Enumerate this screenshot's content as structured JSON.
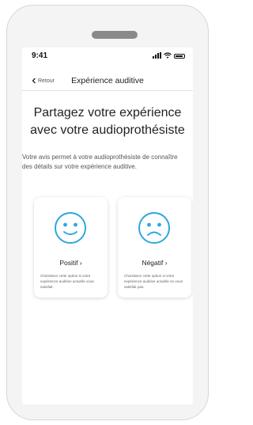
{
  "status_bar": {
    "time": "9:41"
  },
  "nav": {
    "back_label": "Retour",
    "title": "Expérience auditive"
  },
  "headline": {
    "line1": "Partagez votre expérience",
    "line2": "avec votre audioprothésiste"
  },
  "description": "Votre avis permet à votre audioprothésiste de connaître des détails sur votre expérience auditive.",
  "cards": [
    {
      "label": "Positif ›",
      "text": "Choisissez cette option si votre expérience auditive actuelle vous satisfait.",
      "icon": "happy-face-icon"
    },
    {
      "label": "Négatif ›",
      "text": "Choisissez cette option si votre expérience auditive actuelle ne vous satisfait pas.",
      "icon": "sad-face-icon"
    }
  ],
  "colors": {
    "accent": "#2aa8e0",
    "device_bezel": "#f4f4f4",
    "speaker": "#8a8a8a"
  }
}
